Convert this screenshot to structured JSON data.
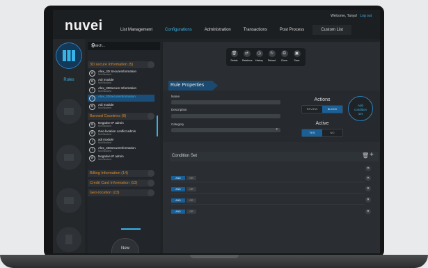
{
  "header": {
    "logo": "nuvei",
    "welcome": "Welcome, Tanya!",
    "logout": "Log out",
    "nav": [
      "List Management",
      "Configurations",
      "Administration",
      "Transactions",
      "Post Process",
      "Custom List"
    ],
    "active_nav": "Configurations"
  },
  "rail": {
    "active_label": "Rules"
  },
  "list_panel": {
    "search_placeholder": "Search...",
    "groups": [
      {
        "label": "3D secure Information (5)"
      },
      {
        "label": "Banned Countries (8)"
      },
      {
        "label": "Billing Information (14)"
      },
      {
        "label": "Credit Card Information (13)"
      },
      {
        "label": "Geo-location (23)"
      }
    ],
    "items_3d": [
      {
        "title": "Alex_3D SecureInformation",
        "sub": "Not Blocked"
      },
      {
        "title": "Adi module",
        "sub": "Not Blocked"
      },
      {
        "title": "Alex_3DSecure Information",
        "sub": "Not Blocked"
      },
      {
        "title": "Alex_3DSecureInformation",
        "sub": ""
      },
      {
        "title": "Adi module",
        "sub": "Not Blocked"
      }
    ],
    "items_banned": [
      {
        "title": "Negative IP admin",
        "sub": "Not Blocked"
      },
      {
        "title": "Geo-location conflict admin",
        "sub": "Not Blocked"
      },
      {
        "title": "adi module",
        "sub": "Not Blocked"
      },
      {
        "title": "Alex_3DSecureInformation",
        "sub": "Not Blocked"
      },
      {
        "title": "Negative IP admin",
        "sub": "Not Blocked"
      }
    ],
    "new_label": "New"
  },
  "toolbar": [
    "Delete",
    "Relations",
    "History",
    "Reload",
    "Clone",
    "Save"
  ],
  "rule_properties": {
    "title": "Rule Properties",
    "name_label": "Name",
    "description_label": "Description",
    "category_label": "Category",
    "actions_title": "Actions",
    "actions": [
      "REVIEW",
      "BLOCK"
    ],
    "active_action": "BLOCK",
    "active_title": "Active",
    "active_opts": [
      "YES",
      "NO"
    ],
    "active_value": "YES",
    "add_condition": [
      "Add",
      "condition",
      "set"
    ]
  },
  "condition_set": {
    "title": "Condition Set",
    "rows": [
      {
        "a": "AND",
        "b": "OR"
      },
      {
        "a": "AND",
        "b": "OR"
      },
      {
        "a": "AND",
        "b": "OR"
      },
      {
        "a": "AND",
        "b": "OR"
      }
    ]
  }
}
